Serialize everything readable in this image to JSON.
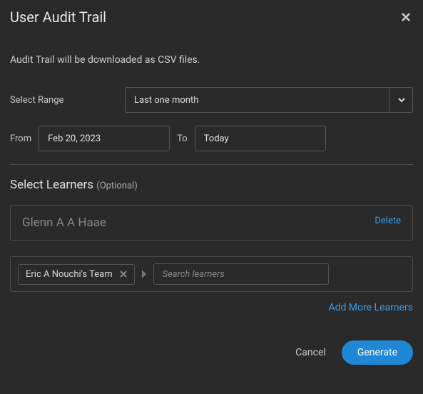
{
  "header": {
    "title": "User Audit Trail"
  },
  "subtitle": "Audit Trail will be downloaded as CSV files.",
  "range": {
    "label": "Select Range",
    "value": "Last one month"
  },
  "dates": {
    "from_label": "From",
    "from_value": "Feb 20, 2023",
    "to_label": "To",
    "to_value": "Today"
  },
  "learners": {
    "title": "Select Learners ",
    "optional": "(Optional)",
    "items": [
      {
        "name": "Glenn A A Haae",
        "delete": "Delete"
      }
    ],
    "team_chip": "Eric A Nouchi's Team",
    "search_placeholder": "Search learners",
    "add_more": "Add More Learners"
  },
  "footer": {
    "cancel": "Cancel",
    "generate": "Generate"
  }
}
